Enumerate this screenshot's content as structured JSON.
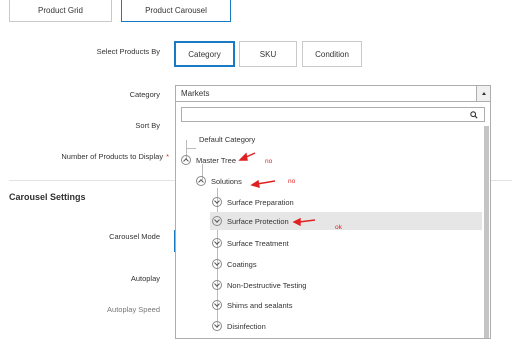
{
  "tabs": [
    {
      "label": "Product Grid",
      "active": false
    },
    {
      "label": "Product Carousel",
      "active": true
    }
  ],
  "form": {
    "select_products_by": {
      "label": "Select Products By",
      "options": [
        "Category",
        "SKU",
        "Condition"
      ],
      "selected": "Category"
    },
    "category": {
      "label": "Category",
      "value": "Markets"
    },
    "sort_by": {
      "label": "Sort By"
    },
    "number_to_display": {
      "label": "Number of Products to Display",
      "required_mark": "*"
    }
  },
  "carousel_settings": {
    "title": "Carousel Settings",
    "mode_label": "Carousel Mode",
    "autoplay_label": "Autoplay",
    "autoplay_speed_label": "Autoplay Speed"
  },
  "tree": {
    "items": [
      {
        "label": "Default Category"
      },
      {
        "label": "Master Tree",
        "state": "expanded"
      },
      {
        "label": "Solutions",
        "state": "expanded"
      },
      {
        "label": "Surface Preparation",
        "state": "collapsed"
      },
      {
        "label": "Surface Protection",
        "state": "collapsed",
        "selected": true
      },
      {
        "label": "Surface Treatment",
        "state": "collapsed"
      },
      {
        "label": "Coatings",
        "state": "collapsed"
      },
      {
        "label": "Non-Destructive Testing",
        "state": "collapsed"
      },
      {
        "label": "Shims and sealants",
        "state": "collapsed"
      },
      {
        "label": "Disinfection",
        "state": "collapsed"
      }
    ]
  },
  "annotations": {
    "note1": "no",
    "note2": "no",
    "note3": "ok",
    "color": "#e02020"
  },
  "colors": {
    "accent": "#1979c3",
    "required": "#e22626",
    "selected_row": "#e6e6e6"
  },
  "icons": {
    "search": "search-icon",
    "select_arrow": "triangle-up-icon",
    "toggle": "chevron-circle-icon"
  }
}
